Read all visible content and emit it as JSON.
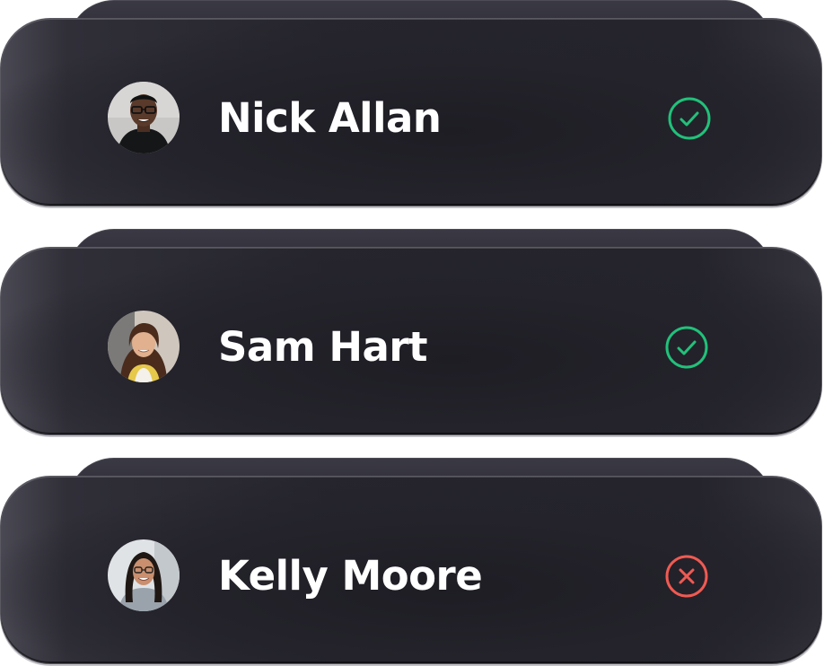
{
  "users": [
    {
      "name": "Nick Allan",
      "status": "approved",
      "status_icon": "check-circle-icon",
      "status_color": "#21c17a"
    },
    {
      "name": "Sam Hart",
      "status": "approved",
      "status_icon": "check-circle-icon",
      "status_color": "#21c17a"
    },
    {
      "name": "Kelly Moore",
      "status": "rejected",
      "status_icon": "x-circle-icon",
      "status_color": "#f05a52"
    }
  ]
}
